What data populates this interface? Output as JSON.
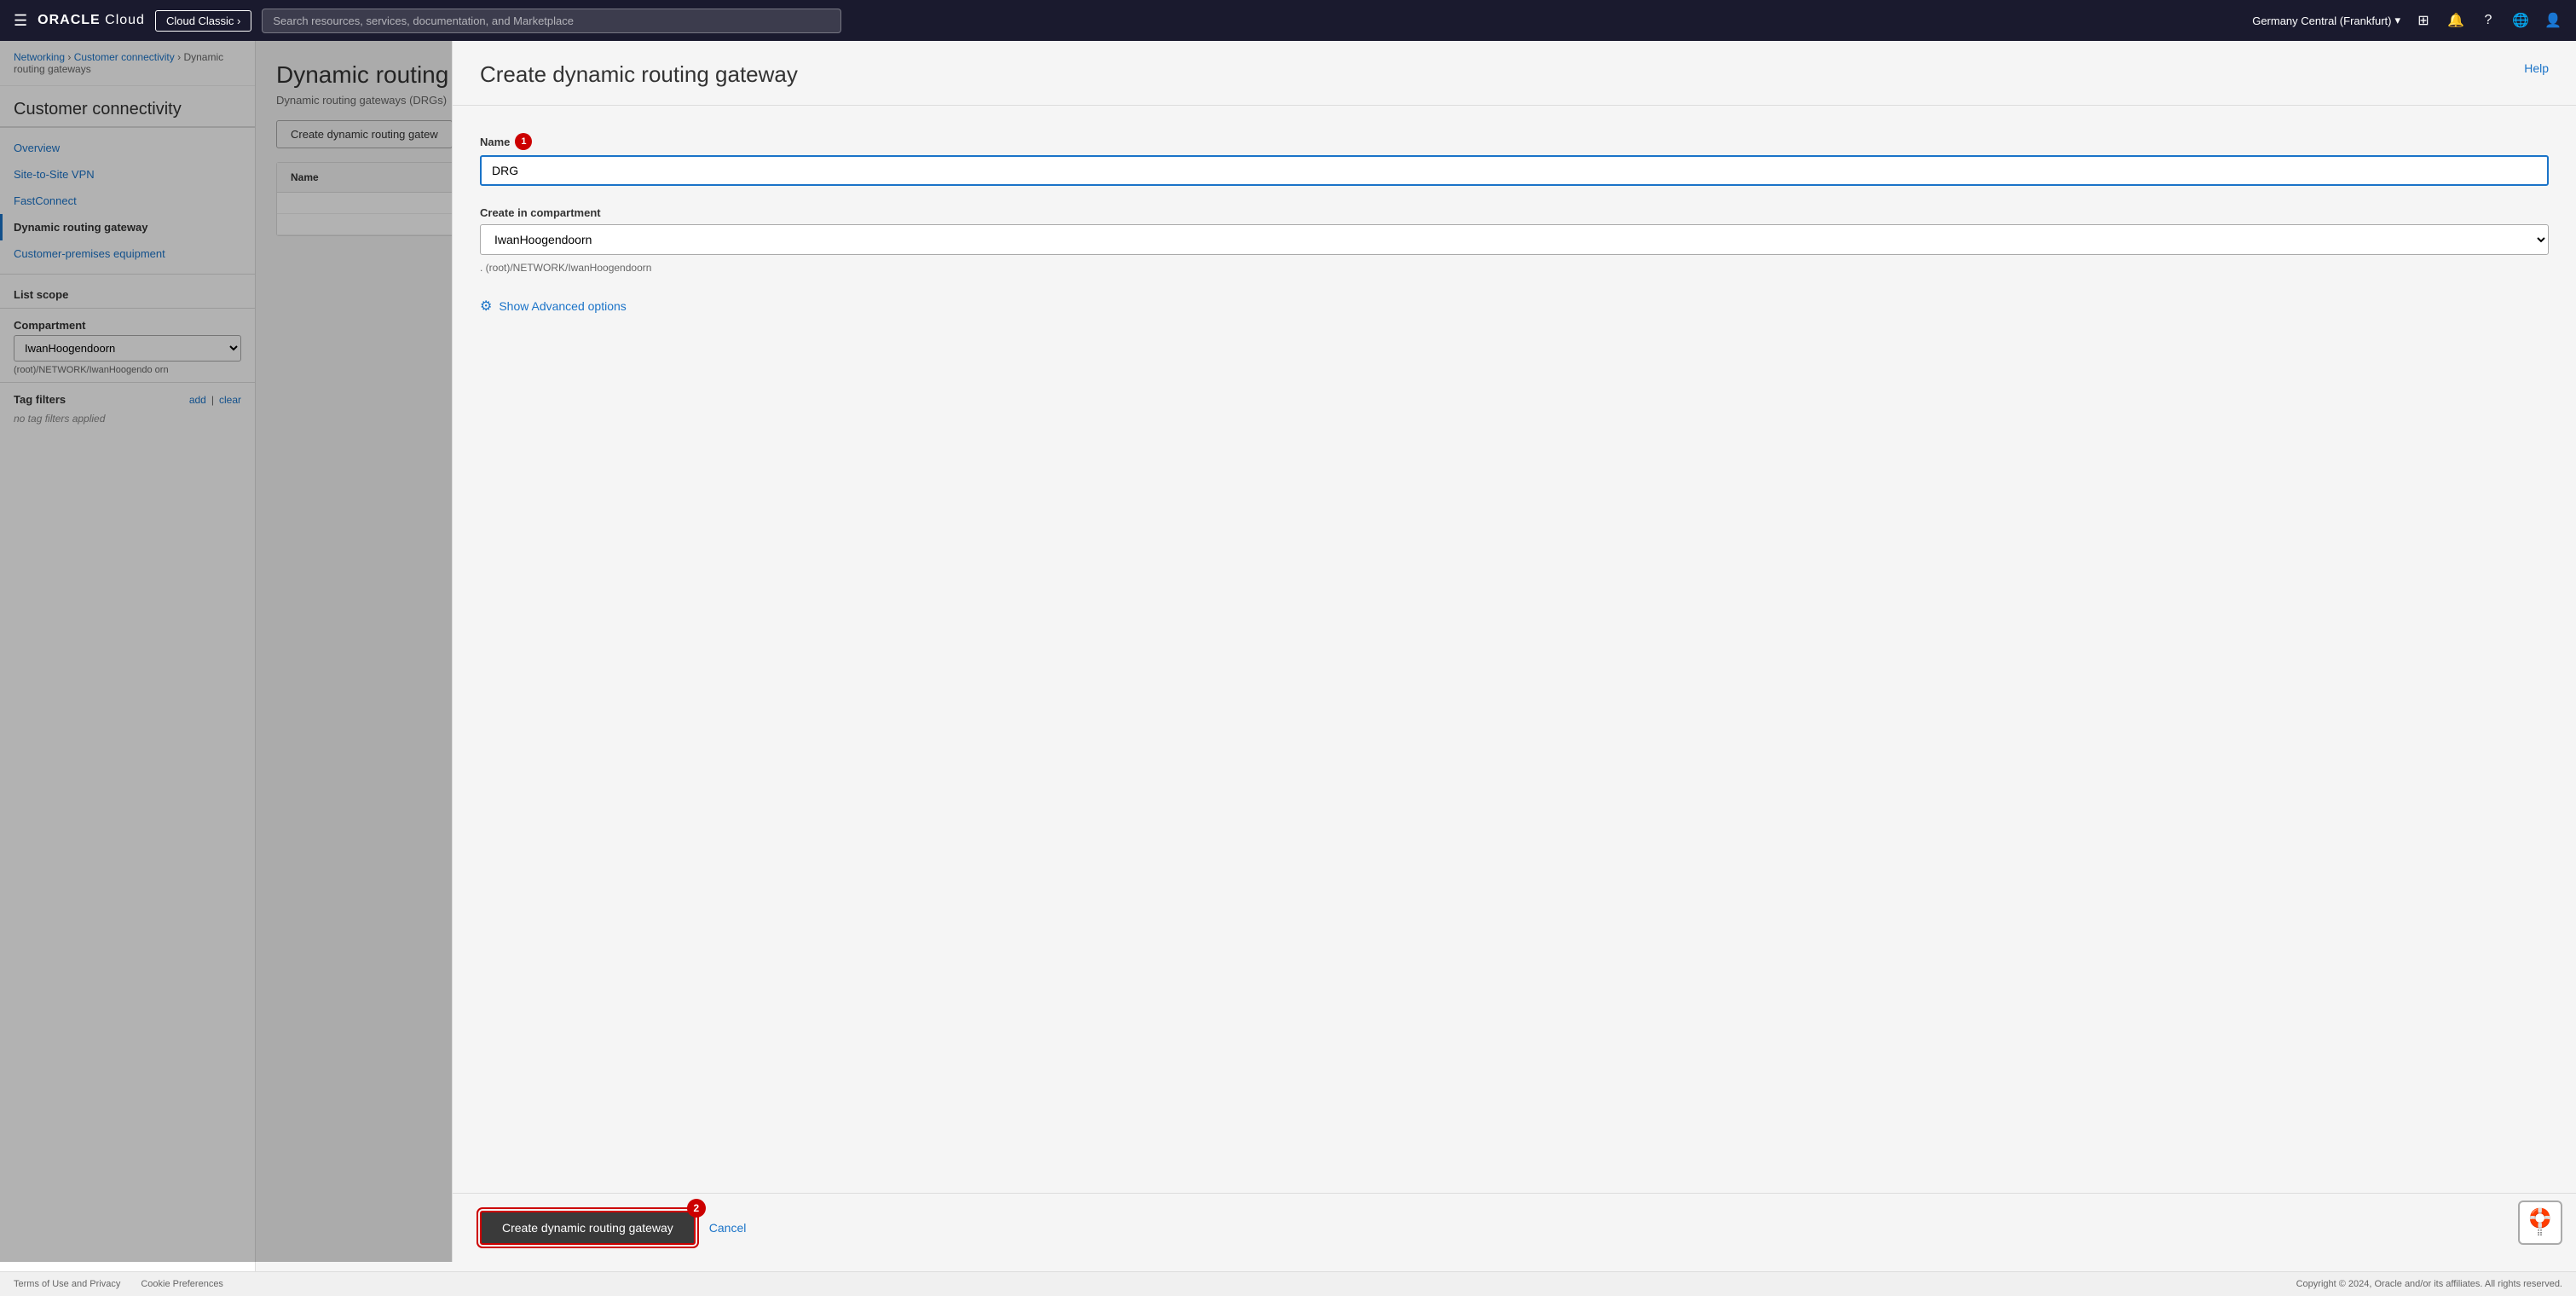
{
  "topnav": {
    "hamburger": "☰",
    "logo_prefix": "ORACLE",
    "logo_suffix": " Cloud",
    "cloud_classic_label": "Cloud Classic ›",
    "search_placeholder": "Search resources, services, documentation, and Marketplace",
    "region": "Germany Central (Frankfurt)",
    "icons": {
      "console": "⬜",
      "bell": "🔔",
      "help": "?",
      "globe": "🌐",
      "user": "👤"
    }
  },
  "breadcrumb": {
    "networking": "Networking",
    "customer_connectivity": "Customer connectivity",
    "dynamic_routing_gateways": "Dynamic routing gateways"
  },
  "sidebar": {
    "title": "Customer connectivity",
    "nav_items": [
      {
        "label": "Overview",
        "active": false
      },
      {
        "label": "Site-to-Site VPN",
        "active": false
      },
      {
        "label": "FastConnect",
        "active": false
      },
      {
        "label": "Dynamic routing gateway",
        "active": true
      },
      {
        "label": "Customer-premises equipment",
        "active": false
      }
    ],
    "list_scope": "List scope",
    "compartment_label": "Compartment",
    "compartment_value": "IwanHoogendoorn",
    "compartment_path": "(root)/NETWORK/IwanHoogendo\norn",
    "tag_filters": "Tag filters",
    "tag_add": "add",
    "tag_separator": "|",
    "tag_clear": "clear",
    "no_filters": "no tag filters applied"
  },
  "content": {
    "title": "Dynamic routing g",
    "description": "Dynamic routing gateways (DRGs)",
    "create_button": "Create dynamic routing gatew"
  },
  "table": {
    "columns": [
      "Name"
    ]
  },
  "modal": {
    "title": "Create dynamic routing gateway",
    "help_label": "Help",
    "name_label": "Name",
    "name_required_badge": "1",
    "name_value": "DRG",
    "compartment_label": "Create in compartment",
    "compartment_value": "IwanHoogendoorn",
    "compartment_path": ". (root)/NETWORK/IwanHoogendoorn",
    "advanced_label": "Show Advanced options",
    "create_button": "Create dynamic routing gateway",
    "create_badge": "2",
    "cancel_label": "Cancel"
  },
  "footer": {
    "terms": "Terms of Use and Privacy",
    "cookies": "Cookie Preferences",
    "copyright": "Copyright © 2024, Oracle and/or its affiliates. All rights reserved."
  }
}
